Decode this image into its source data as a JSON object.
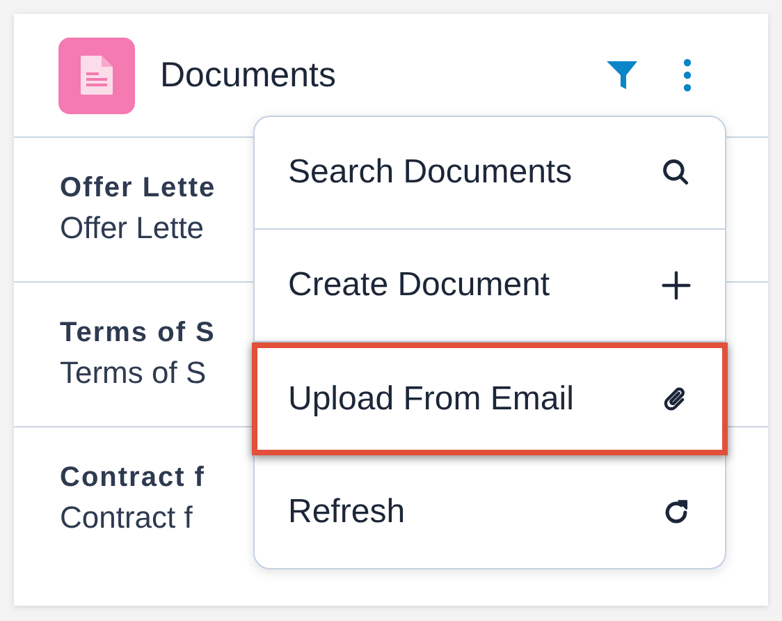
{
  "card": {
    "title": "Documents",
    "rows": [
      {
        "name": "Offer Lette",
        "subtitle": "Offer Lette"
      },
      {
        "name": "Terms of S",
        "subtitle": "Terms of S"
      },
      {
        "name": "Contract f",
        "subtitle": "Contract f"
      }
    ]
  },
  "menu": {
    "items": [
      {
        "label": "Search Documents",
        "highlighted": false
      },
      {
        "label": "Create Document",
        "highlighted": false
      },
      {
        "label": "Upload From Email",
        "highlighted": true
      },
      {
        "label": "Refresh",
        "highlighted": false
      }
    ]
  }
}
